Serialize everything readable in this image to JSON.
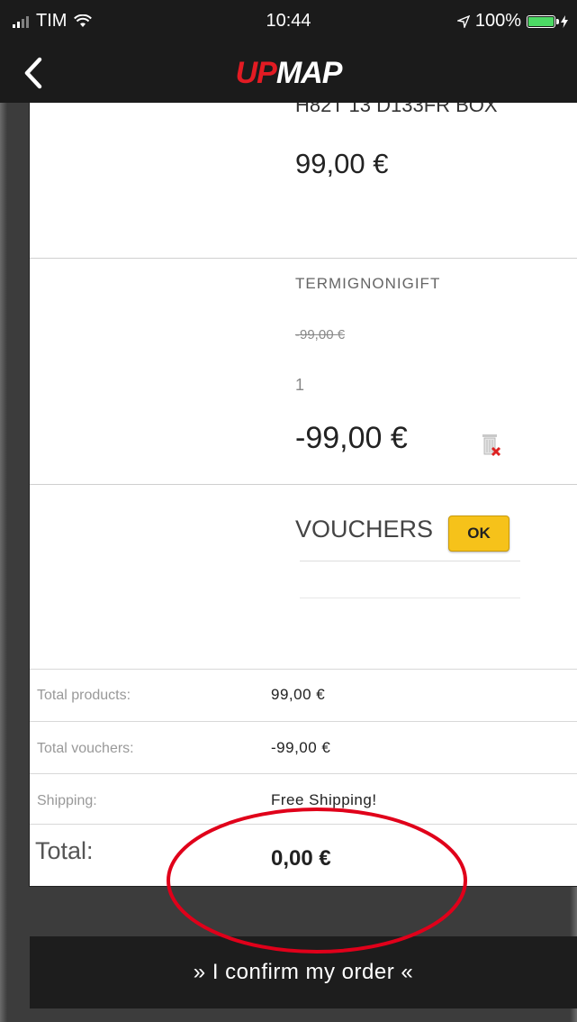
{
  "status_bar": {
    "carrier": "TIM",
    "time": "10:44",
    "battery": "100%",
    "battery_level": 1.0,
    "icons": [
      "signal-bars-icon",
      "wifi-icon",
      "location-arrow-icon",
      "battery-icon",
      "charging-bolt-icon"
    ]
  },
  "nav": {
    "back_icon": "chevron-left-icon",
    "logo_part1": "UP",
    "logo_part2": "MAP",
    "colors": {
      "logo_red": "#e31b23",
      "bar": "#1b1b1b"
    }
  },
  "product": {
    "name_clipped": "H82T 13 D133FR BOX",
    "price": "99,00 €"
  },
  "voucher_item": {
    "name": "TERMIGNONIGIFT",
    "price_old": "-99,00 €",
    "quantity": "1",
    "price": "-99,00 €",
    "delete_icon": "trash-delete-icon"
  },
  "vouchers_form": {
    "label": "VOUCHERS",
    "ok_button": "OK",
    "input_value": "",
    "ok_color": "#f6c21a"
  },
  "summary": {
    "total_products_label": "Total products:",
    "total_products_value": "99,00 €",
    "total_vouchers_label": "Total vouchers:",
    "total_vouchers_value": "-99,00 €",
    "shipping_label": "Shipping:",
    "shipping_value": "Free Shipping!",
    "total_label": "Total:",
    "total_value": "0,00 €"
  },
  "confirm_button": "» I confirm my order «",
  "annotation": {
    "shape": "ellipse",
    "color": "#e0001a"
  }
}
